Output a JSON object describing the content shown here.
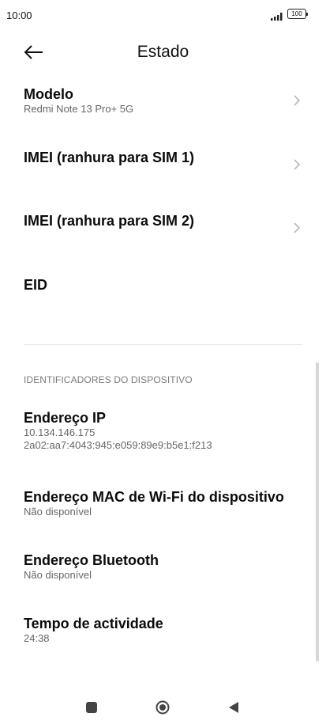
{
  "status_bar": {
    "time": "10:00",
    "signal_icon": "signal-bars-icon",
    "battery_icon": "battery-icon",
    "battery_level": "100"
  },
  "header": {
    "back_icon": "arrow-left-icon",
    "title": "Estado"
  },
  "items": [
    {
      "title": "Modelo",
      "subtitle": "Redmi Note 13 Pro+ 5G",
      "chevron": true
    },
    {
      "title": "IMEI (ranhura para SIM 1)",
      "chevron": true
    },
    {
      "title": "IMEI (ranhura para SIM 2)",
      "chevron": true
    },
    {
      "title": "EID",
      "chevron": false
    }
  ],
  "section": {
    "header": "IDENTIFICADORES DO DISPOSITIVO",
    "items": [
      {
        "title": "Endereço IP",
        "lines": [
          "10.134.146.175",
          "2a02:aa7:4043:945:e059:89e9:b5e1:f213"
        ]
      },
      {
        "title": "Endereço MAC de Wi-Fi do dispositivo",
        "lines": [
          "Não disponível"
        ]
      },
      {
        "title": "Endereço Bluetooth",
        "lines": [
          "Não disponível"
        ]
      },
      {
        "title": "Tempo de actividade",
        "lines": [
          "24:38"
        ]
      }
    ]
  },
  "nav_bar": {
    "recent_icon": "square-recent-apps-icon",
    "home_icon": "circle-home-icon",
    "back_icon": "triangle-back-icon"
  },
  "colors": {
    "background": "#ffffff",
    "title_text": "#0b0b0b",
    "secondary_text": "#666666",
    "section_header": "#7a7a7a",
    "chevron": "#b8b8b8"
  }
}
